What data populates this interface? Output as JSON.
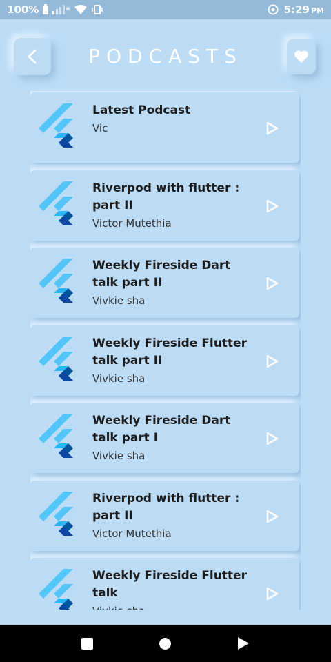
{
  "status_bar": {
    "battery_percent": "100%",
    "time": "5:29",
    "ampm": "PM"
  },
  "header": {
    "title": "PODCASTS",
    "back_icon": "chevron-left-icon",
    "favorite_icon": "heart-icon"
  },
  "podcasts": [
    {
      "title": "Latest Podcast",
      "author": "Vic"
    },
    {
      "title": "Riverpod with flutter : part II",
      "author": "Victor Mutethia"
    },
    {
      "title": "Weekly Fireside Dart talk part II",
      "author": "Vivkie sha"
    },
    {
      "title": "Weekly Fireside Flutter talk part II",
      "author": "Vivkie sha"
    },
    {
      "title": "Weekly Fireside Dart talk part I",
      "author": "Vivkie sha"
    },
    {
      "title": "Riverpod with flutter : part II",
      "author": "Victor Mutethia"
    },
    {
      "title": "Weekly Fireside Flutter talk",
      "author": "Vivkie sha"
    }
  ],
  "colors": {
    "background": "#bcdcf6",
    "status_bar": "#93b8d8",
    "flutter_light": "#54c5f8",
    "flutter_dark": "#01579b",
    "flutter_mid": "#29b6f6"
  }
}
